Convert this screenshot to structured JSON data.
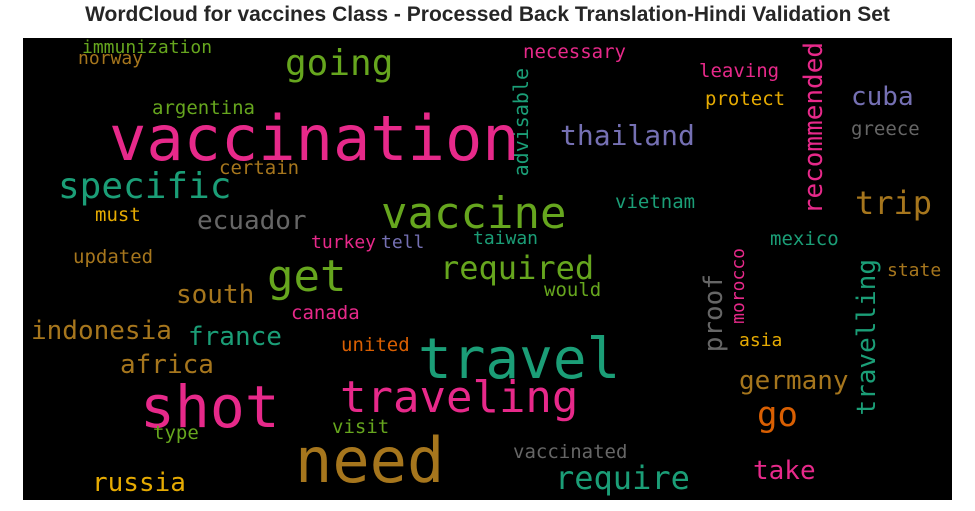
{
  "title": "WordCloud for vaccines Class - Processed Back Translation-Hindi Validation Set",
  "colors": {
    "pink": "#e7298a",
    "teal": "#1b9e77",
    "green": "#66a61e",
    "gold": "#a6761d",
    "yellow": "#e6ab02",
    "purple": "#7570b3",
    "orange": "#d95f02",
    "gray": "#666666",
    "background": "#000000"
  },
  "words": {
    "immunization": "immunization",
    "norway": "norway",
    "going": "going",
    "necessary": "necessary",
    "advisable": "advisable",
    "leaving": "leaving",
    "recommended": "recommended",
    "cuba": "cuba",
    "argentina": "argentina",
    "protect": "protect",
    "vaccination": "vaccination",
    "thailand": "thailand",
    "greece": "greece",
    "certain": "certain",
    "specific": "specific",
    "vaccine": "vaccine",
    "trip": "trip",
    "vietnam": "vietnam",
    "must": "must",
    "ecuador": "ecuador",
    "taiwan": "taiwan",
    "mexico": "mexico",
    "turkey": "turkey",
    "tell": "tell",
    "updated": "updated",
    "get": "get",
    "required": "required",
    "morocco": "morocco",
    "state": "state",
    "south": "south",
    "would": "would",
    "travelling": "travelling",
    "proof": "proof",
    "canada": "canada",
    "indonesia": "indonesia",
    "france": "france",
    "united": "united",
    "travel": "travel",
    "asia": "asia",
    "africa": "africa",
    "germany": "germany",
    "shot": "shot",
    "traveling": "traveling",
    "go": "go",
    "type": "type",
    "visit": "visit",
    "need": "need",
    "vaccinated": "vaccinated",
    "take": "take",
    "require": "require",
    "russia": "russia"
  }
}
